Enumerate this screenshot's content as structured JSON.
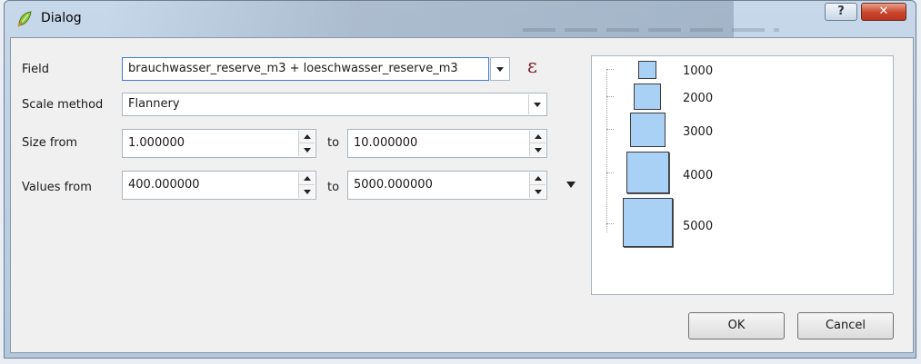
{
  "window": {
    "title": "Dialog",
    "help_glyph": "?",
    "close_glyph": "✕"
  },
  "form": {
    "field_label": "Field",
    "field_value": "brauchwasser_reserve_m3 + loeschwasser_reserve_m3",
    "expression_glyph": "ε",
    "scale_method_label": "Scale method",
    "scale_method_value": "Flannery",
    "size_from_label": "Size from",
    "size_from_value": "1.000000",
    "size_to_label": "to",
    "size_to_value": "10.000000",
    "values_from_label": "Values from",
    "values_from_value": "400.000000",
    "values_to_label": "to",
    "values_to_value": "5000.000000"
  },
  "legend": {
    "fill_color": "#a9d0f5",
    "items": [
      {
        "label": "1000"
      },
      {
        "label": "2000"
      },
      {
        "label": "3000"
      },
      {
        "label": "4000"
      },
      {
        "label": "5000"
      }
    ]
  },
  "buttons": {
    "ok_label": "OK",
    "cancel_label": "Cancel"
  }
}
